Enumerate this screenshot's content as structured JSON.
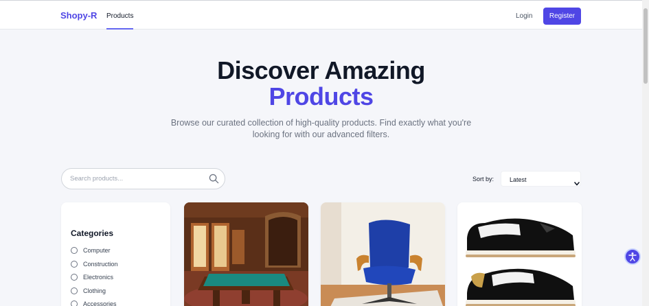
{
  "nav": {
    "brand": "Shopy-R",
    "products_link": "Products",
    "login_link": "Login",
    "register_button": "Register"
  },
  "hero": {
    "title_line1": "Discover Amazing",
    "title_line2": "Products",
    "subtitle": "Browse our curated collection of high-quality products. Find exactly what you're looking for with our advanced filters."
  },
  "search": {
    "placeholder": "Search products..."
  },
  "sort": {
    "label": "Sort by:",
    "selected": "Latest"
  },
  "filters": {
    "title": "Categories",
    "categories": [
      "Computer",
      "Construction",
      "Electronics",
      "Clothing",
      "Accessories"
    ]
  },
  "products": [
    {
      "image": "billiard-table-photo"
    },
    {
      "image": "office-chair-photo"
    },
    {
      "image": "patent-leather-sneakers-photo"
    }
  ],
  "colors": {
    "accent": "#4f46e5",
    "background": "#f5f6fa"
  }
}
